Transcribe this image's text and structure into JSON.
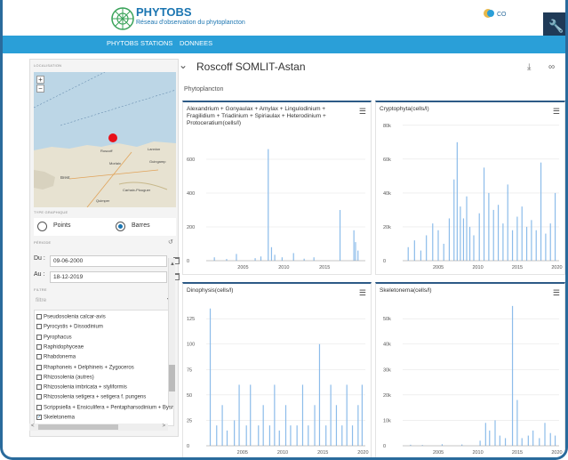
{
  "header": {
    "brand_title": "PHYTOBS",
    "brand_subtitle": "Réseau d'observation du phytoplancton",
    "partner": "CO"
  },
  "nav": [
    "PHYTOBS",
    "STATIONS",
    "DONNEES"
  ],
  "sidebar": {
    "location_heading": "LOCALISATION",
    "map_labels": [
      "Roscoff",
      "Lannion",
      "Brest",
      "Morlaix",
      "Quimper",
      "Carhaix-Plouguer",
      "Guingamp"
    ],
    "graph_type_heading": "TYPE GRAPHIQUE",
    "graph_types": [
      "Points",
      "Barres"
    ],
    "selected_graph_type": "Barres",
    "period_heading": "PÉRIODE",
    "date_from_label": "Du :",
    "date_from": "09-06-2000",
    "date_to_label": "Au :",
    "date_to": "18-12-2019",
    "filter_heading": "FILTRE",
    "filter_placeholder": "filtre",
    "taxa": [
      {
        "label": "Pseudosolenia calcar-avis",
        "checked": false
      },
      {
        "label": "Pyrocystis + Dissodinium",
        "checked": false
      },
      {
        "label": "Pyrophacus",
        "checked": false
      },
      {
        "label": "Raphidophyceae",
        "checked": false
      },
      {
        "label": "Rhabdonema",
        "checked": false
      },
      {
        "label": "Rhaphoneis + Delphineis + Zygoceros",
        "checked": false
      },
      {
        "label": "Rhizosolenia (autres)",
        "checked": false
      },
      {
        "label": "Rhizosolenia imbricata + styliformis",
        "checked": false
      },
      {
        "label": "Rhizosolenia setigera + setigera f. pungens",
        "checked": false
      },
      {
        "label": "Scrippsiella + Ensiculifera + Pentapharsodinium + Bysmatrum + Chotdinium",
        "checked": false
      },
      {
        "label": "Skeletonema",
        "checked": true
      }
    ]
  },
  "main": {
    "station_title": "Roscoff SOMLIT-Astan",
    "section_label": "Phytoplancton",
    "download_icon": "download-icon",
    "link_icon": "link-icon"
  },
  "chart_data": [
    {
      "type": "bar",
      "title": "Alexandrium + Gonyaulax + Amylax + Lingulodinium + Fragilidium + Triadinium + Spiriaulax + Heterodinium + Protoceratium(cells/l)",
      "x_ticks": [
        "2005",
        "2010",
        "2015"
      ],
      "y_ticks": [
        0,
        200,
        400,
        600
      ],
      "ylim": [
        0,
        700
      ],
      "xlim": [
        2000.5,
        2020
      ],
      "x": [
        2001.5,
        2003.0,
        2004.2,
        2006.5,
        2007.2,
        2008.1,
        2008.5,
        2008.9,
        2009.8,
        2011.2,
        2012.5,
        2013.7,
        2016.9,
        2018.6,
        2018.8,
        2019.1
      ],
      "values": [
        20,
        10,
        40,
        15,
        25,
        660,
        80,
        35,
        20,
        45,
        12,
        20,
        300,
        180,
        110,
        60
      ],
      "color": "#8cbcea"
    },
    {
      "type": "bar",
      "title": "Cryptophyta(cells/l)",
      "x_ticks": [
        "2005",
        "2010",
        "2015",
        "2020"
      ],
      "y_ticks": [
        0,
        20000,
        40000,
        60000,
        80000
      ],
      "y_tick_labels": [
        "0",
        "20k",
        "40k",
        "60k",
        "80k"
      ],
      "ylim": [
        0,
        82000
      ],
      "xlim": [
        2000.5,
        2020.3
      ],
      "x": [
        2001.2,
        2002.0,
        2002.8,
        2003.5,
        2004.3,
        2005.0,
        2005.7,
        2006.4,
        2007.0,
        2007.4,
        2007.8,
        2008.2,
        2008.6,
        2009.0,
        2009.5,
        2010.2,
        2010.8,
        2011.4,
        2012.0,
        2012.6,
        2013.2,
        2013.8,
        2014.4,
        2015.0,
        2015.6,
        2016.2,
        2016.8,
        2017.4,
        2018.0,
        2018.6,
        2019.2,
        2019.8
      ],
      "values": [
        8000,
        12000,
        6000,
        15000,
        22000,
        18000,
        10000,
        25000,
        48000,
        70000,
        32000,
        25000,
        38000,
        20000,
        15000,
        28000,
        55000,
        40000,
        30000,
        33000,
        22000,
        45000,
        18000,
        26000,
        32000,
        20000,
        24000,
        18000,
        58000,
        16000,
        22000,
        40000
      ],
      "color": "#8cbcea"
    },
    {
      "type": "bar",
      "title": "Dinophysis(cells/l)",
      "x_ticks": [
        "2005",
        "2010",
        "2015",
        "2020"
      ],
      "y_ticks": [
        0,
        25,
        50,
        75,
        100,
        125
      ],
      "ylim": [
        0,
        140
      ],
      "xlim": [
        2000.5,
        2020.3
      ],
      "x": [
        2001.0,
        2001.8,
        2002.5,
        2003.1,
        2004.0,
        2004.6,
        2005.5,
        2006.0,
        2007.0,
        2007.6,
        2008.4,
        2009.0,
        2009.6,
        2010.4,
        2011.0,
        2011.8,
        2012.5,
        2013.2,
        2014.0,
        2014.6,
        2015.4,
        2016.0,
        2016.7,
        2017.4,
        2018.0,
        2018.7,
        2019.4,
        2019.9
      ],
      "values": [
        135,
        20,
        40,
        15,
        25,
        60,
        20,
        60,
        20,
        40,
        20,
        60,
        15,
        40,
        20,
        20,
        60,
        20,
        40,
        100,
        20,
        60,
        40,
        20,
        60,
        20,
        40,
        60
      ],
      "color": "#8cbcea"
    },
    {
      "type": "bar",
      "title": "Skeletonema(cells/l)",
      "x_ticks": [
        "2005",
        "2010",
        "2015",
        "2020"
      ],
      "y_ticks": [
        0,
        10000,
        20000,
        30000,
        40000,
        50000
      ],
      "y_tick_labels": [
        "0",
        "10k",
        "20k",
        "30k",
        "40k",
        "50k"
      ],
      "ylim": [
        0,
        56000
      ],
      "xlim": [
        2000.5,
        2020.3
      ],
      "x": [
        2001.5,
        2003.0,
        2005.5,
        2008.0,
        2010.3,
        2011.0,
        2011.5,
        2012.2,
        2012.8,
        2013.5,
        2014.4,
        2015.0,
        2015.6,
        2016.4,
        2017.0,
        2017.8,
        2018.5,
        2019.2,
        2019.8
      ],
      "values": [
        400,
        300,
        600,
        500,
        2000,
        9000,
        6000,
        10000,
        4000,
        3000,
        55000,
        18000,
        3000,
        4000,
        6000,
        3000,
        9000,
        5000,
        4000
      ],
      "color": "#8cbcea"
    }
  ]
}
